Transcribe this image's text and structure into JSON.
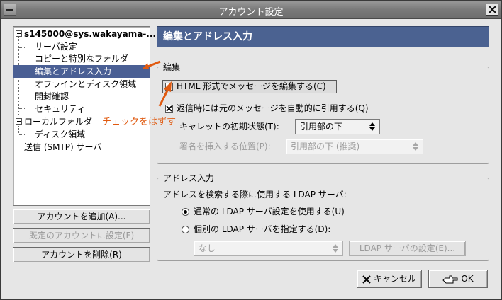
{
  "window": {
    "title": "アカウント設定"
  },
  "tree": {
    "items": [
      {
        "label": "s145000@sys.wakayama-..."
      },
      {
        "label": "サーバ設定"
      },
      {
        "label": "コピーと特別なフォルダ"
      },
      {
        "label": "編集とアドレス入力"
      },
      {
        "label": "オフラインとディスク領域"
      },
      {
        "label": "開封確認"
      },
      {
        "label": "セキュリティ"
      },
      {
        "label": "ローカルフォルダ"
      },
      {
        "label": "ディスク領域"
      },
      {
        "label": "送信 (SMTP) サーバ"
      }
    ],
    "selected_index": 3
  },
  "side_buttons": {
    "add": "アカウントを追加(A)...",
    "default": "既定のアカウントに設定(F)",
    "remove": "アカウントを削除(R)"
  },
  "panel": {
    "header": "編集とアドレス入力",
    "compose": {
      "group_label": "編集",
      "html_checkbox": "HTML 形式でメッセージを編集する(C)",
      "quote_checkbox": "返信時には元のメッセージを自動的に引用する(Q)",
      "caret_label": "キャレットの初期状態(T):",
      "caret_value": "引用部の下",
      "signature_label": "署名を挿入する位置(P):",
      "signature_value": "引用部の下 (推奨)"
    },
    "addressing": {
      "group_label": "アドレス入力",
      "description": "アドレスを検索する際に使用する LDAP サーバ:",
      "radio_global": "通常の LDAP サーバ設定を使用する(U)",
      "radio_custom": "個別の LDAP サーバを指定する(D):",
      "server_value": "なし",
      "edit_button": "LDAP サーバの設定(E)..."
    }
  },
  "footer": {
    "cancel": "キャンセル",
    "ok": "OK"
  },
  "annotation": {
    "text": "チェックをはずす"
  },
  "colors": {
    "accent": "#4b6291",
    "annotation": "#e05a10"
  }
}
